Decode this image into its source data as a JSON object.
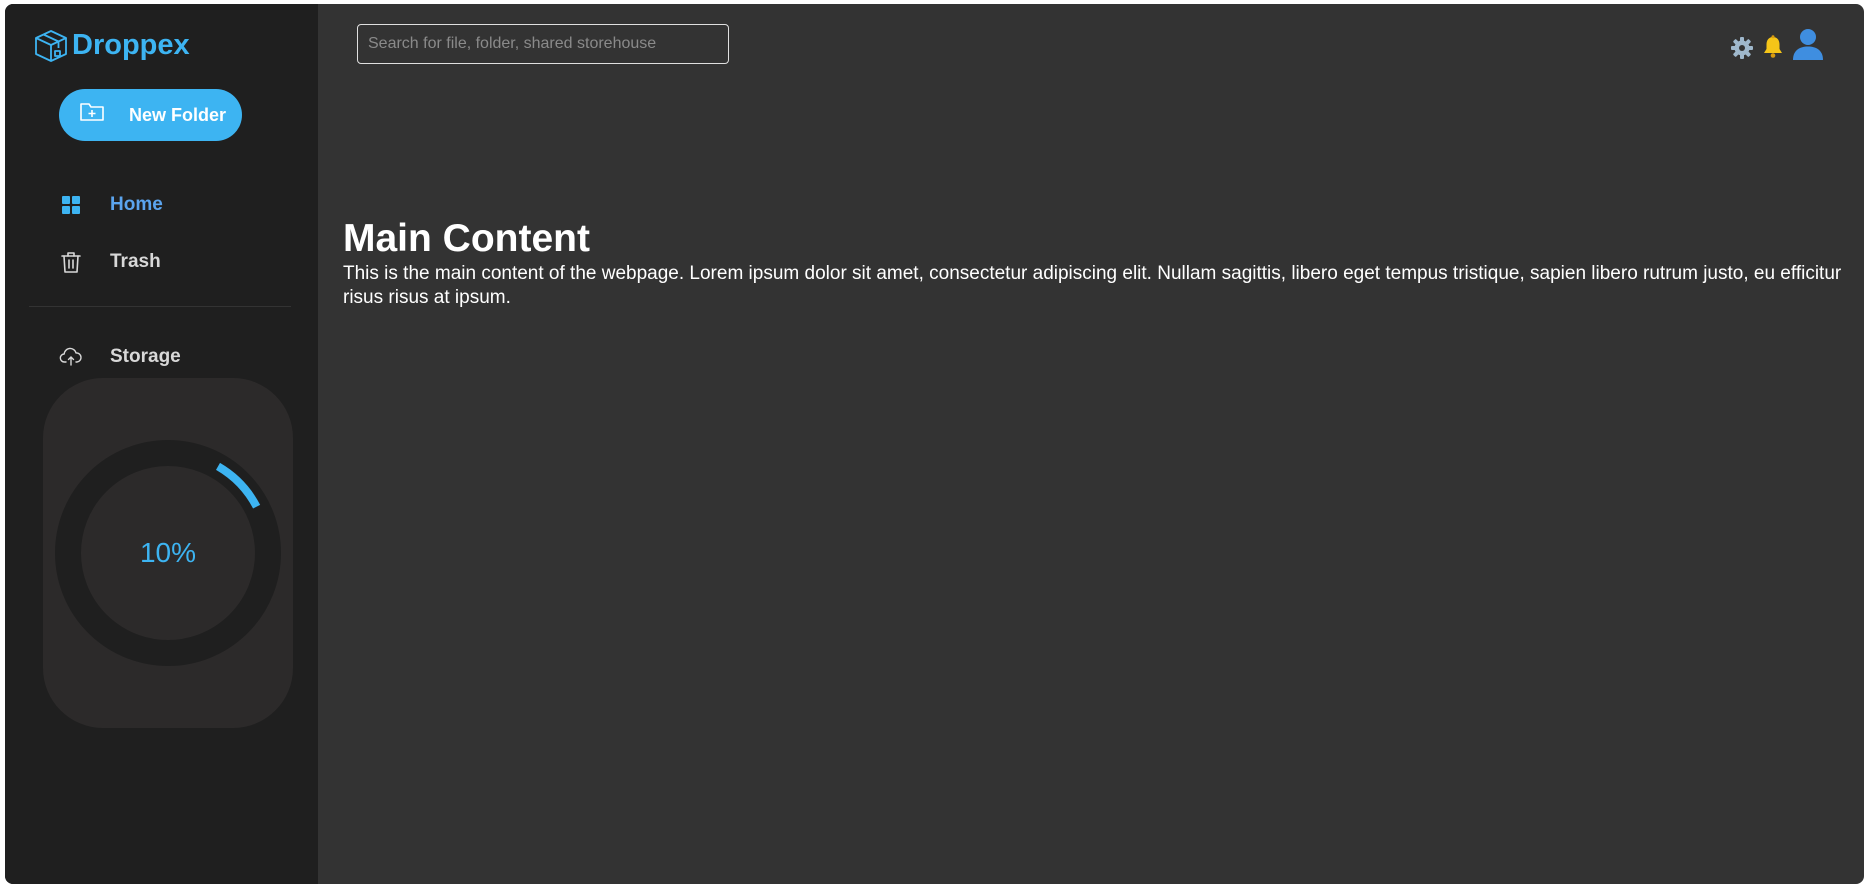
{
  "brand": {
    "name": "Droppex",
    "logo_icon": "box-icon",
    "accent_color": "#3db4f2"
  },
  "sidebar": {
    "new_folder_label": "New Folder",
    "new_folder_icon": "folder-plus-icon",
    "items": [
      {
        "label": "Home",
        "icon": "grid-icon",
        "active": true
      },
      {
        "label": "Trash",
        "icon": "trash-icon",
        "active": false
      },
      {
        "label": "Storage",
        "icon": "cloud-upload-icon",
        "active": false
      }
    ],
    "storage": {
      "used_percent": 10,
      "used_label": "10%"
    }
  },
  "header": {
    "search_placeholder": "Search for file, folder, shared storehouse",
    "icons": [
      "gear-icon",
      "bell-icon",
      "user-icon"
    ]
  },
  "main": {
    "title": "Main Content",
    "text": "This is the main content of the webpage. Lorem ipsum dolor sit amet, consectetur adipiscing elit. Nullam sagittis, libero eget tempus tristique, sapien libero rutrum justo, eu efficitur risus risus at ipsum."
  }
}
